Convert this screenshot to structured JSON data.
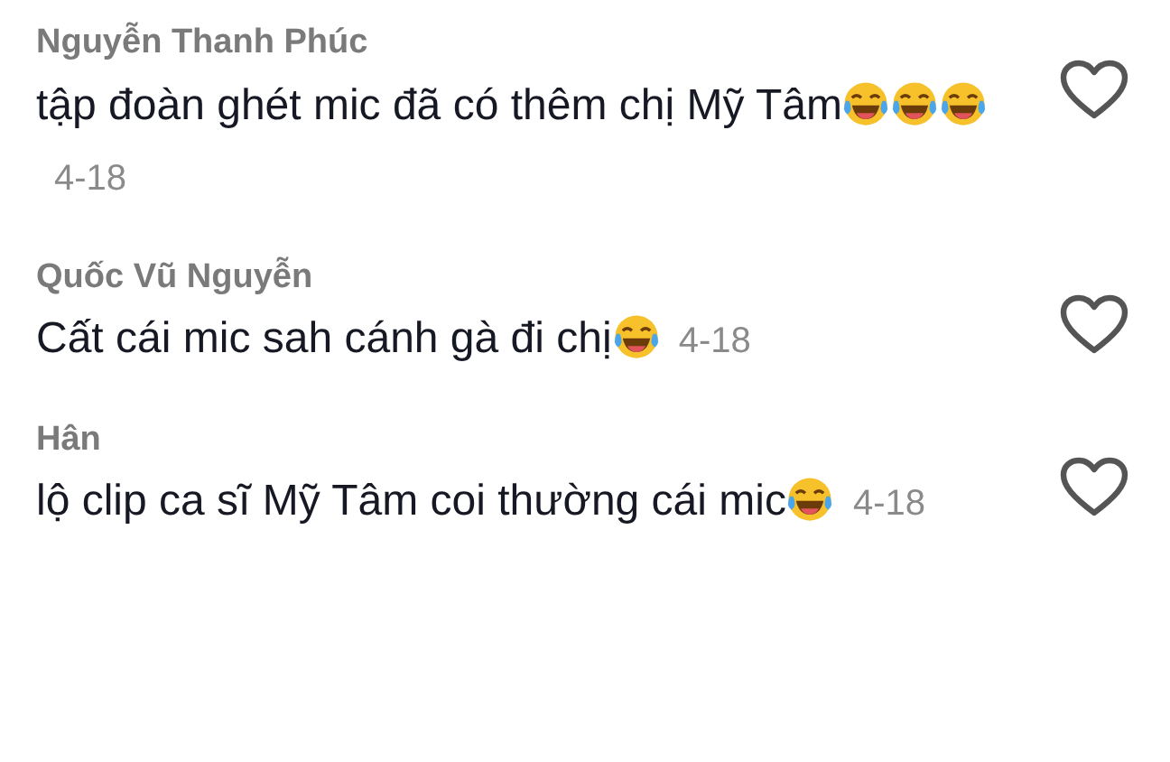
{
  "comments": [
    {
      "author": "Nguyễn Thanh Phúc",
      "body": [
        {
          "kind": "text",
          "text": "tập đoàn ghét mic đã có thêm chị Mỹ Tâm"
        },
        {
          "kind": "emoji"
        },
        {
          "kind": "emoji"
        },
        {
          "kind": "emoji"
        }
      ],
      "date": "4-18",
      "liked": false
    },
    {
      "author": "Quốc Vũ Nguyễn",
      "body": [
        {
          "kind": "text",
          "text": "Cất cái mic sah cánh gà đi chị"
        },
        {
          "kind": "emoji"
        }
      ],
      "date": "4-18",
      "liked": false
    },
    {
      "author": "Hân",
      "body": [
        {
          "kind": "text",
          "text": "lộ clip ca sĩ Mỹ Tâm coi thường cái mic"
        },
        {
          "kind": "emoji"
        }
      ],
      "date": "4-18",
      "liked": false
    }
  ]
}
